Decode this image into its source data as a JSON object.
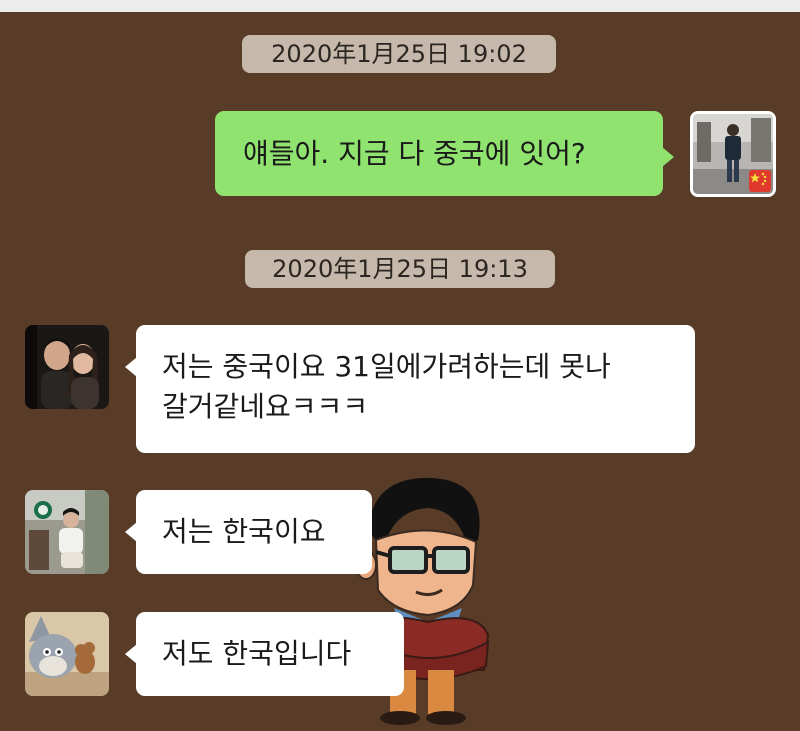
{
  "colors": {
    "background": "#583c28",
    "outgoing_bubble": "#8fe36e",
    "incoming_bubble": "#ffffff",
    "timestamp_pill": "#ebe1d6"
  },
  "messages": {
    "time_1": "2020年1月25日 19:02",
    "outgoing_1": "얘들아.  지금 다 중국에 잇어?",
    "time_2": "2020年1月25日 19:13",
    "incoming_1_line_1": "저는 중국이요 31일에가려하는데 못나",
    "incoming_1_line_2": "갈거같네요ㅋㅋㅋ",
    "incoming_2": "저는 한국이요",
    "incoming_3": "저도 한국입니다"
  },
  "icons": {
    "self_avatar_badge": "china-flag-icon",
    "sticker": "cartoon-man-sticker"
  }
}
